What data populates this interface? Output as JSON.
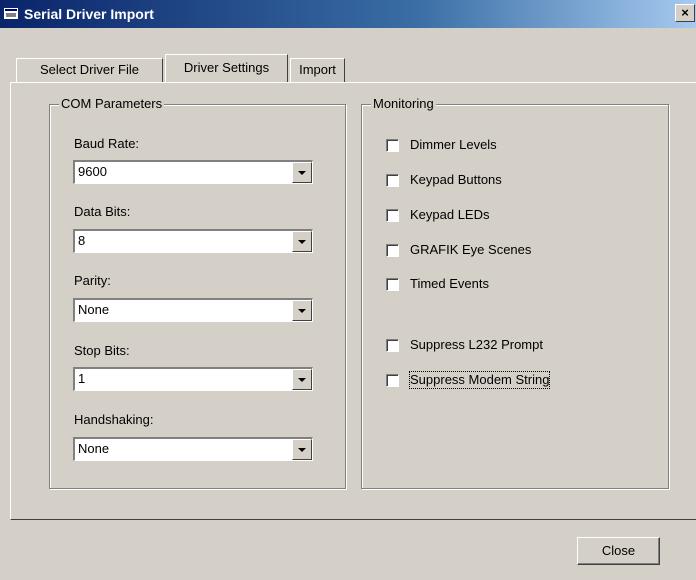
{
  "window": {
    "title": "Serial Driver Import",
    "close_glyph": "×",
    "app_icon": "window-app-icon"
  },
  "tabs": [
    {
      "label": "Select Driver File"
    },
    {
      "label": "Driver Settings",
      "active": true
    },
    {
      "label": "Import"
    }
  ],
  "com_parameters": {
    "title": "COM Parameters",
    "fields": [
      {
        "label": "Baud Rate:",
        "value": "9600"
      },
      {
        "label": "Data Bits:",
        "value": "8"
      },
      {
        "label": "Parity:",
        "value": "None"
      },
      {
        "label": "Stop Bits:",
        "value": "1"
      },
      {
        "label": "Handshaking:",
        "value": "None"
      }
    ]
  },
  "monitoring": {
    "title": "Monitoring",
    "options": [
      {
        "label": "Dimmer Levels",
        "checked": false
      },
      {
        "label": "Keypad Buttons",
        "checked": false
      },
      {
        "label": "Keypad LEDs",
        "checked": false
      },
      {
        "label": "GRAFIK Eye Scenes",
        "checked": false
      },
      {
        "label": "Timed Events",
        "checked": false
      },
      {
        "label": "Suppress L232 Prompt",
        "checked": false
      },
      {
        "label": "Suppress Modem String",
        "checked": false
      }
    ]
  },
  "footer": {
    "close_label": "Close"
  }
}
